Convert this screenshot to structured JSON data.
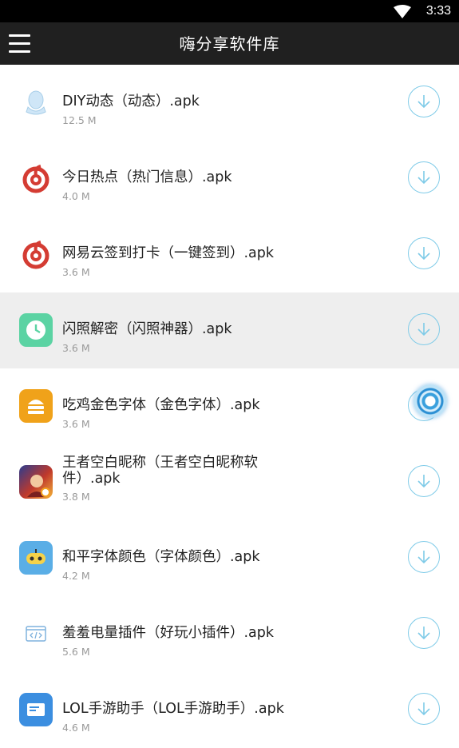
{
  "status_bar": {
    "time": "3:33"
  },
  "app_bar": {
    "title": "嗨分享软件库"
  },
  "items": [
    {
      "name": "DIY动态（动态）.apk",
      "size": "12.5 M",
      "icon": "qq-penguin-icon"
    },
    {
      "name": "今日热点（热门信息）.apk",
      "size": "4.0 M",
      "icon": "netease-music-icon"
    },
    {
      "name": "网易云签到打卡（一键签到）.apk",
      "size": "3.6 M",
      "icon": "netease-music-icon"
    },
    {
      "name": "闪照解密（闪照神器）.apk",
      "size": "3.6 M",
      "icon": "clock-icon"
    },
    {
      "name": "吃鸡金色字体（金色字体）.apk",
      "size": "3.6 M",
      "icon": "gold-stack-icon"
    },
    {
      "name": "王者空白昵称（王者空白昵称软件）.apk",
      "size": "3.8 M",
      "icon": "game-hero-icon"
    },
    {
      "name": "和平字体颜色（字体颜色）.apk",
      "size": "4.2 M",
      "icon": "robot-face-icon"
    },
    {
      "name": "羞羞电量插件（好玩小插件）.apk",
      "size": "5.6 M",
      "icon": "code-window-icon"
    },
    {
      "name": "LOL手游助手（LOL手游助手）.apk",
      "size": "4.6 M",
      "icon": "blue-card-icon"
    }
  ],
  "colors": {
    "status_bar_bg": "#000000",
    "app_bar_bg": "#202020",
    "download_accent": "#7fcbe8",
    "highlight_row": "#eeeeee"
  }
}
